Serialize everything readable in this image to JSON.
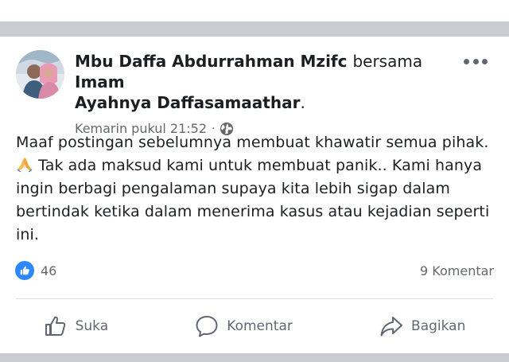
{
  "post": {
    "author": "Mbu Daffa Abdurrahman Mzifc",
    "with_text": "bersama",
    "tagged_line1": "Imam",
    "tagged_line2": "Ayahnya Daffasamaathar",
    "tagged_suffix": ".",
    "timestamp": "Kemarin pukul 21:52",
    "separator": "·",
    "audience_icon": "globe-icon",
    "body_part1": "Maaf postingan sebelumnya membuat khawatir semua pihak.",
    "body_part2": "Tak ada maksud kami untuk membuat panik.. Kami hanya ingin berbagi pengalaman supaya kita lebih sigap dalam bertindak ketika dalam menerima kasus atau kejadian seperti ini.",
    "emoji": "folded-hands-emoji"
  },
  "stats": {
    "reaction_icon": "like-icon",
    "reaction_count": "46",
    "comments": "9 Komentar"
  },
  "actions": {
    "like": "Suka",
    "comment": "Komentar",
    "share": "Bagikan"
  },
  "colors": {
    "separator_gray": "#c9ccd1",
    "text_primary": "#1c1e21",
    "text_secondary": "#65676b",
    "like_blue": "#2d88ff"
  }
}
